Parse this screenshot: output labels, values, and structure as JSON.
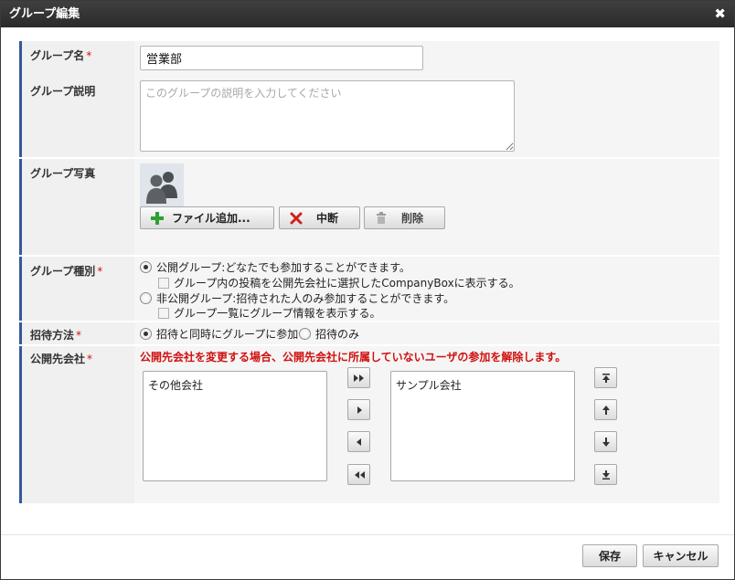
{
  "dialog": {
    "title": "グループ編集",
    "close_symbol": "✖"
  },
  "fields": {
    "name": {
      "label": "グループ名",
      "required_mark": "*",
      "value": "営業部"
    },
    "description": {
      "label": "グループ説明",
      "placeholder": "このグループの説明を入力してください",
      "value": ""
    },
    "photo": {
      "label": "グループ写真",
      "buttons": {
        "add": "ファイル追加...",
        "stop": "中断",
        "delete": "削除"
      }
    },
    "type": {
      "label": "グループ種別",
      "required_mark": "*",
      "options": [
        {
          "label": "公開グループ:どなたでも参加することができます。",
          "selected": true,
          "sub_option": "グループ内の投稿を公開先会社に選択したCompanyBoxに表示する。",
          "sub_checked": false
        },
        {
          "label": "非公開グループ:招待された人のみ参加することができます。",
          "selected": false,
          "sub_option": "グループ一覧にグループ情報を表示する。",
          "sub_checked": false
        }
      ]
    },
    "invite": {
      "label": "招待方法",
      "required_mark": "*",
      "options": [
        {
          "label": "招待と同時にグループに参加",
          "selected": true
        },
        {
          "label": "招待のみ",
          "selected": false
        }
      ]
    },
    "companies": {
      "label": "公開先会社",
      "required_mark": "*",
      "warning": "公開先会社を変更する場合、公開先会社に所属していないユーザの参加を解除します。",
      "available": [
        "その他会社"
      ],
      "selected": [
        "サンプル会社"
      ]
    }
  },
  "footer": {
    "save": "保存",
    "cancel": "キャンセル"
  },
  "colors": {
    "titlebar": "#333333",
    "label_border": "#34599a",
    "warning": "#d01010",
    "add_icon": "#2ea02e",
    "stop_icon": "#d02020"
  },
  "icons": [
    "close-icon",
    "plus-icon",
    "x-icon",
    "trash-icon",
    "move-all-right-icon",
    "move-right-icon",
    "move-left-icon",
    "move-all-left-icon",
    "move-top-icon",
    "move-up-icon",
    "move-down-icon",
    "move-bottom-icon"
  ]
}
